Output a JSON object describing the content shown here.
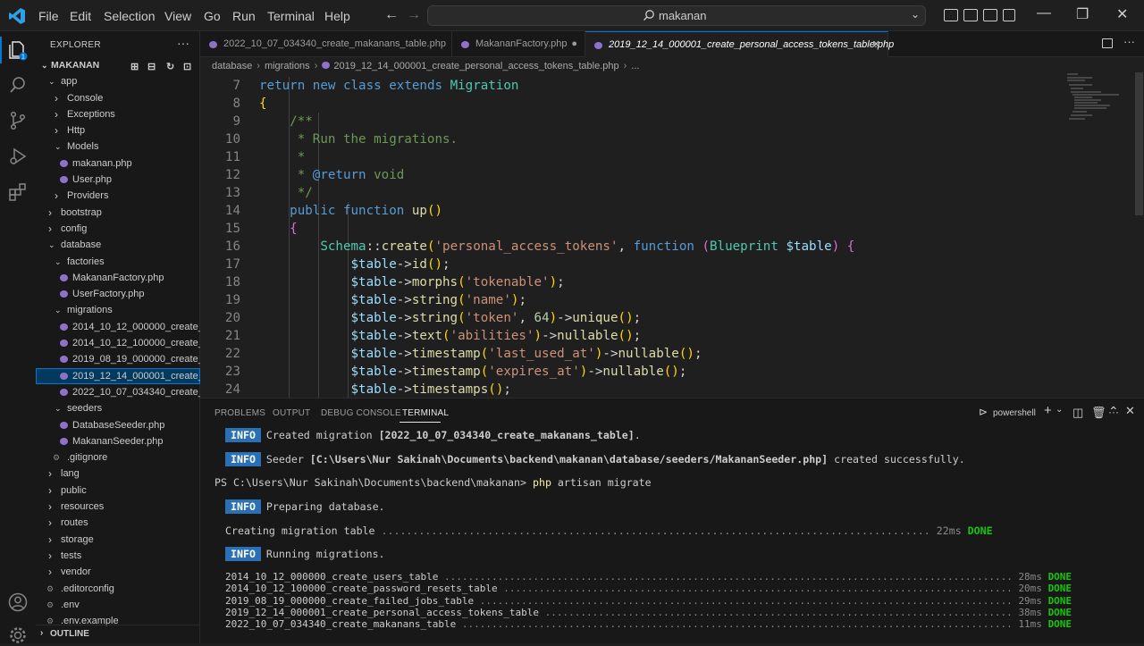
{
  "menu": [
    "File",
    "Edit",
    "Selection",
    "View",
    "Go",
    "Run",
    "Terminal",
    "Help"
  ],
  "search": {
    "text": "makanan"
  },
  "explorer": {
    "header": "EXPLORER",
    "root": "MAKANAN",
    "outline": "OUTLINE",
    "items": [
      {
        "label": "app",
        "depth": 1,
        "type": "folder",
        "open": true
      },
      {
        "label": "Console",
        "depth": 2,
        "type": "folder",
        "open": false
      },
      {
        "label": "Exceptions",
        "depth": 2,
        "type": "folder",
        "open": false
      },
      {
        "label": "Http",
        "depth": 2,
        "type": "folder",
        "open": false
      },
      {
        "label": "Models",
        "depth": 2,
        "type": "folder",
        "open": true
      },
      {
        "label": "makanan.php",
        "depth": 3,
        "type": "php"
      },
      {
        "label": "User.php",
        "depth": 3,
        "type": "php"
      },
      {
        "label": "Providers",
        "depth": 2,
        "type": "folder",
        "open": false
      },
      {
        "label": "bootstrap",
        "depth": 1,
        "type": "folder",
        "open": false
      },
      {
        "label": "config",
        "depth": 1,
        "type": "folder",
        "open": false
      },
      {
        "label": "database",
        "depth": 1,
        "type": "folder",
        "open": true
      },
      {
        "label": "factories",
        "depth": 2,
        "type": "folder",
        "open": true
      },
      {
        "label": "MakananFactory.php",
        "depth": 3,
        "type": "php"
      },
      {
        "label": "UserFactory.php",
        "depth": 3,
        "type": "php"
      },
      {
        "label": "migrations",
        "depth": 2,
        "type": "folder",
        "open": true
      },
      {
        "label": "2014_10_12_000000_create_...",
        "depth": 3,
        "type": "php"
      },
      {
        "label": "2014_10_12_100000_create_...",
        "depth": 3,
        "type": "php"
      },
      {
        "label": "2019_08_19_000000_create_...",
        "depth": 3,
        "type": "php"
      },
      {
        "label": "2019_12_14_000001_create_...",
        "depth": 3,
        "type": "php",
        "selected": true
      },
      {
        "label": "2022_10_07_034340_create_...",
        "depth": 3,
        "type": "php"
      },
      {
        "label": "seeders",
        "depth": 2,
        "type": "folder",
        "open": true
      },
      {
        "label": "DatabaseSeeder.php",
        "depth": 3,
        "type": "php"
      },
      {
        "label": "MakananSeeder.php",
        "depth": 3,
        "type": "php"
      },
      {
        "label": ".gitignore",
        "depth": 2,
        "type": "file"
      },
      {
        "label": "lang",
        "depth": 1,
        "type": "folder",
        "open": false
      },
      {
        "label": "public",
        "depth": 1,
        "type": "folder",
        "open": false
      },
      {
        "label": "resources",
        "depth": 1,
        "type": "folder",
        "open": false
      },
      {
        "label": "routes",
        "depth": 1,
        "type": "folder",
        "open": false
      },
      {
        "label": "storage",
        "depth": 1,
        "type": "folder",
        "open": false
      },
      {
        "label": "tests",
        "depth": 1,
        "type": "folder",
        "open": false
      },
      {
        "label": "vendor",
        "depth": 1,
        "type": "folder",
        "open": false
      },
      {
        "label": ".editorconfig",
        "depth": 1,
        "type": "file"
      },
      {
        "label": ".env",
        "depth": 1,
        "type": "file"
      },
      {
        "label": ".env.example",
        "depth": 1,
        "type": "file"
      }
    ]
  },
  "tabs": [
    {
      "label": "2022_10_07_034340_create_makanans_table.php",
      "mark": ""
    },
    {
      "label": "MakananFactory.php",
      "mark": "●"
    },
    {
      "label": "2019_12_14_000001_create_personal_access_tokens_table.php",
      "mark": "✕"
    }
  ],
  "breadcrumb": [
    "database",
    "migrations",
    "2019_12_14_000001_create_personal_access_tokens_table.php",
    "..."
  ],
  "code": [
    {
      "n": "7",
      "t": "return new class extends Migration"
    },
    {
      "n": "8",
      "t": "{"
    },
    {
      "n": "9",
      "t": "    /**"
    },
    {
      "n": "10",
      "t": "     * Run the migrations."
    },
    {
      "n": "11",
      "t": "     *"
    },
    {
      "n": "12",
      "t": "     * @return void"
    },
    {
      "n": "13",
      "t": "     */"
    },
    {
      "n": "14",
      "t": "    public function up()"
    },
    {
      "n": "15",
      "t": "    {"
    },
    {
      "n": "16",
      "t": "        Schema::create('personal_access_tokens', function (Blueprint $table) {"
    },
    {
      "n": "17",
      "t": "            $table->id();"
    },
    {
      "n": "18",
      "t": "            $table->morphs('tokenable');"
    },
    {
      "n": "19",
      "t": "            $table->string('name');"
    },
    {
      "n": "20",
      "t": "            $table->string('token', 64)->unique();"
    },
    {
      "n": "21",
      "t": "            $table->text('abilities')->nullable();"
    },
    {
      "n": "22",
      "t": "            $table->timestamp('last_used_at')->nullable();"
    },
    {
      "n": "23",
      "t": "            $table->timestamp('expires_at')->nullable();"
    },
    {
      "n": "24",
      "t": "            $table->timestamps();"
    }
  ],
  "panel": {
    "tabs": [
      "PROBLEMS",
      "OUTPUT",
      "DEBUG CONSOLE",
      "TERMINAL"
    ],
    "shell": "powershell"
  },
  "terminal": {
    "info": "INFO",
    "l1a": "Created migration ",
    "l1b": "[2022_10_07_034340_create_makanans_table]",
    "l1c": ".",
    "l2a": "Seeder ",
    "l2b": "[C:\\Users\\Nur Sakinah\\Documents\\backend\\makanan\\database/seeders/MakananSeeder.php]",
    "l2c": " created successfully.",
    "prompt": "PS C:\\Users\\Nur Sakinah\\Documents\\backend\\makanan> ",
    "cmd1": "php",
    "cmd2": " artisan migrate",
    "l3": "Preparing database.",
    "creating": "Creating migration table ",
    "creating_time": "22ms",
    "done": "DONE",
    "l4": "Running migrations.",
    "migrations": [
      {
        "name": "2014_10_12_000000_create_users_table",
        "time": "28ms"
      },
      {
        "name": "2014_10_12_100000_create_password_resets_table",
        "time": "20ms"
      },
      {
        "name": "2019_08_19_000000_create_failed_jobs_table",
        "time": "29ms"
      },
      {
        "name": "2019_12_14_000001_create_personal_access_tokens_table",
        "time": "38ms"
      },
      {
        "name": "2022_10_07_034340_create_makanans_table",
        "time": "11ms"
      }
    ]
  },
  "colors": {
    "accent": "#0078d4",
    "info_bg": "#2b70b5",
    "done": "#16c60c"
  }
}
